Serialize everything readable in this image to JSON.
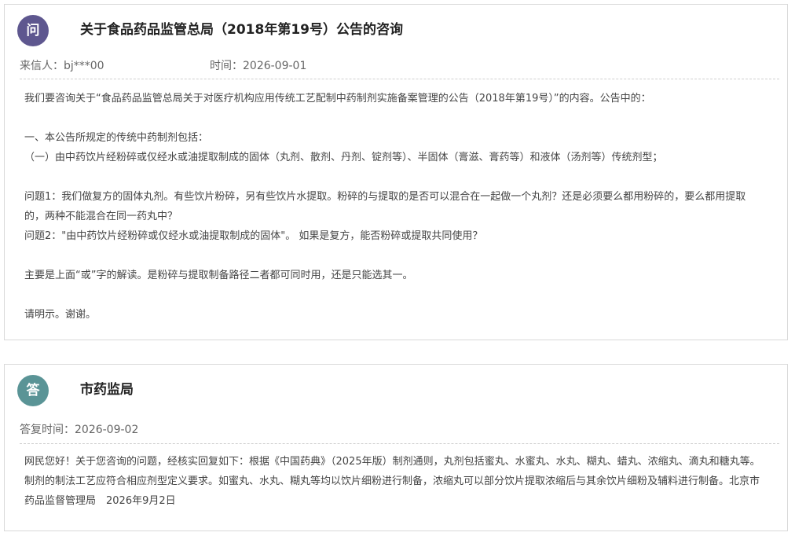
{
  "question": {
    "badge": "问",
    "title": "关于食品药品监管总局（2018年第19号）公告的咨询",
    "sender": "来信人：bj***00",
    "time": "时间：2026-09-01",
    "paragraphs": [
      "我们要咨询关于“食品药品监管总局关于对医疗机构应用传统工艺配制中药制剂实施备案管理的公告（2018年第19号）”的内容。公告中的：",
      "",
      "一、本公告所规定的传统中药制剂包括：",
      "（一）由中药饮片经粉碎或仅经水或油提取制成的固体（丸剂、散剂、丹剂、锭剂等）、半固体（膏滋、膏药等）和液体（汤剂等）传统剂型；",
      "",
      "问题1：我们做复方的固体丸剂。有些饮片粉碎，另有些饮片水提取。粉碎的与提取的是否可以混合在一起做一个丸剂？还是必须要么都用粉碎的，要么都用提取的，两种不能混合在同一药丸中？",
      "问题2：\"由中药饮片经粉碎或仅经水或油提取制成的固体\"。 如果是复方，能否粉碎或提取共同使用？",
      "",
      "主要是上面“或”字的解读。是粉碎与提取制备路径二者都可同时用，还是只能选其一。",
      "",
      "请明示。谢谢。"
    ]
  },
  "answer": {
    "badge": "答",
    "title": "市药监局",
    "reply_time": "答复时间：2026-09-02",
    "paragraphs": [
      "网民您好！关于您咨询的问题，经核实回复如下：根据《中国药典》（2025年版）制剂通则，丸剂包括蜜丸、水蜜丸、水丸、糊丸、蜡丸、浓缩丸、滴丸和糖丸等。制剂的制法工艺应符合相应剂型定义要求。如蜜丸、水丸、糊丸等均以饮片细粉进行制备，浓缩丸可以部分饮片提取浓缩后与其余饮片细粉及辅料进行制备。北京市药品监督管理局　2026年9月2日"
    ]
  }
}
